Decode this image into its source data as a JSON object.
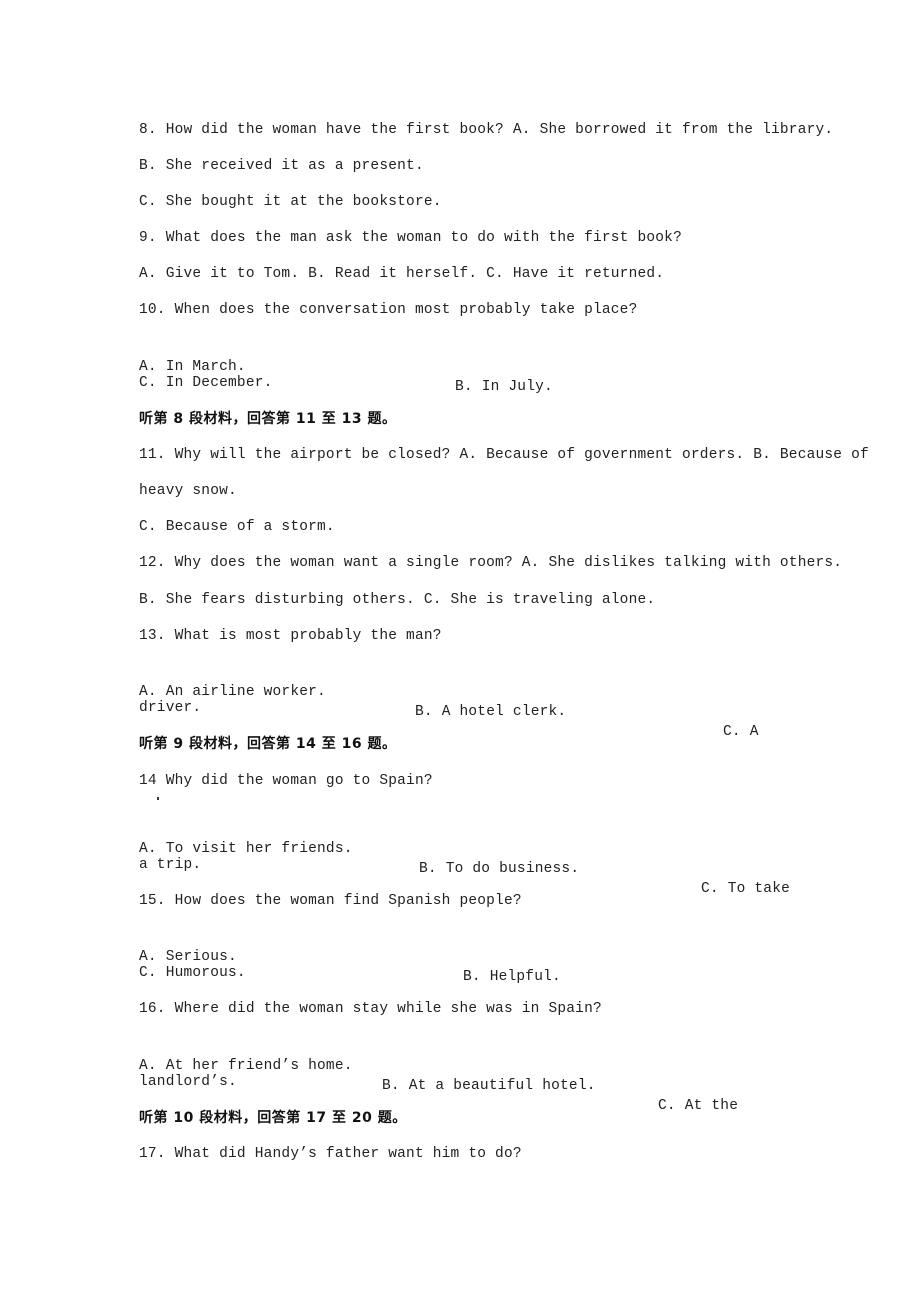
{
  "document": {
    "questions": {
      "q8": {
        "stem": "8. How did the woman have the first book? A. She borrowed it from the library.",
        "option_b": "B. She received it as a present.",
        "option_c": "C. She bought it at the bookstore."
      },
      "q9": {
        "stem": "9. What does the man ask the woman to do with the first book?",
        "options": "A. Give it to Tom. B. Read it herself. C. Have it returned."
      },
      "q10": {
        "stem": "10. When does the conversation most probably take place?",
        "option_a": "A. In March.",
        "option_b": "B. In July.",
        "option_c": "C. In December."
      },
      "section8": "听第 8 段材料，回答第 11 至 13 题。",
      "q11": {
        "stem": "11. Why will the airport be closed? A. Because of government orders. B. Because of",
        "stem_cont": "heavy snow.",
        "option_c": "C. Because of a storm."
      },
      "q12": {
        "stem": "12. Why does the woman want a single room? A. She dislikes talking with others.",
        "options": "B. She fears disturbing others. C. She is traveling alone."
      },
      "q13": {
        "stem": "13. What is most probably the man?",
        "option_a": "A. An airline worker.",
        "option_b": "B. A hotel clerk.",
        "option_c": "C. A",
        "option_c_cont": "driver."
      },
      "section9": "听第 9 段材料，回答第 14 至 16 题。",
      "q14": {
        "stem": "14 Why did the woman go to Spain?",
        "option_a": "A. To visit her friends.",
        "option_b": "B. To do business.",
        "option_c": "C. To take",
        "option_c_cont": "a trip."
      },
      "q15": {
        "stem": "15. How does the woman find Spanish people?",
        "option_a": "A. Serious.",
        "option_b": "B. Helpful.",
        "option_c": "C. Humorous."
      },
      "q16": {
        "stem": "16. Where did the woman stay while she was in Spain?",
        "option_a": "A. At her friend’s home.",
        "option_b": "B. At a beautiful hotel.",
        "option_c": "C. At the",
        "option_c_cont": "landlord’s."
      },
      "section10": "听第 10 段材料，回答第 17 至 20 题。",
      "q17": {
        "stem": "17. What did Handy’s father want him to do?"
      }
    }
  }
}
